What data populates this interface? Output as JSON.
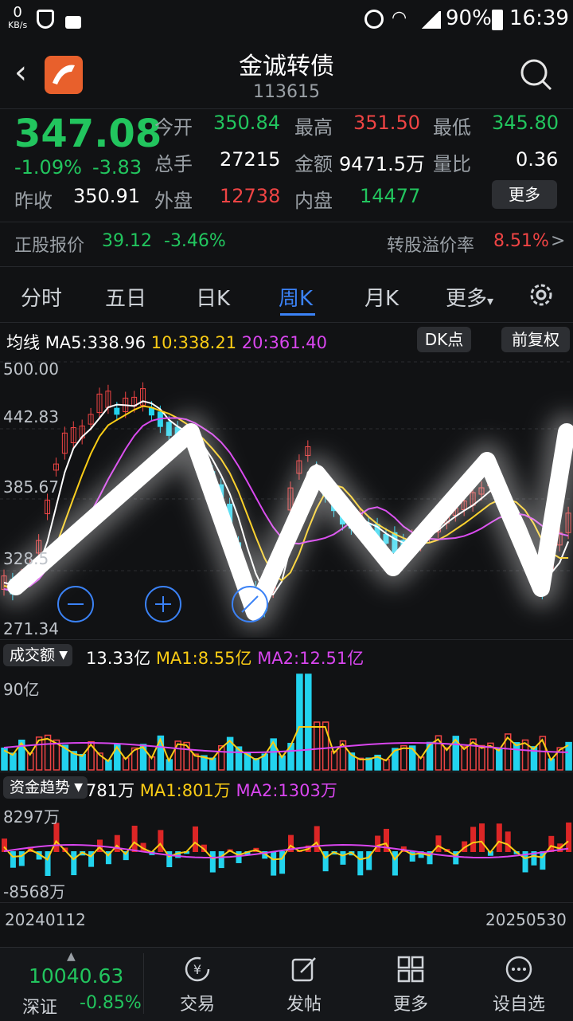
{
  "status_bar": {
    "net_speed": "0",
    "net_unit": "KB/s",
    "battery": "90%",
    "time": "16:39"
  },
  "header": {
    "title": "金诚转债",
    "code": "113615"
  },
  "quote": {
    "price": "347.08",
    "change_pct": "-1.09%",
    "change": "-3.83",
    "prev_close_label": "昨收",
    "prev_close": "350.91",
    "open_label": "今开",
    "open": "350.84",
    "high_label": "最高",
    "high": "351.50",
    "low_label": "最低",
    "low": "345.80",
    "volume_label": "总手",
    "volume": "27215",
    "amount_label": "金额",
    "amount": "9471.5万",
    "ratio_label": "量比",
    "ratio": "0.36",
    "outer_label": "外盘",
    "outer": "12738",
    "inner_label": "内盘",
    "inner": "14477",
    "more_label": "更多"
  },
  "convert": {
    "label": "正股报价",
    "price": "39.12",
    "pct": "-3.46%",
    "premium_label": "转股溢价率",
    "premium": "8.51%",
    "arrow": ">"
  },
  "tabs": {
    "items": [
      "分时",
      "五日",
      "日K",
      "周K",
      "月K",
      "更多"
    ],
    "active": "周K",
    "more_caret": "▾"
  },
  "legend": {
    "ma_label": "均线",
    "ma5": "MA5:338.96",
    "ma10": "10:338.21",
    "ma20": "20:361.40",
    "dk_label": "DK点",
    "adjust_label": "前复权"
  },
  "main_chart": {
    "y_ticks": [
      "500.00",
      "442.83",
      "385.67",
      "328.5",
      "271.34"
    ]
  },
  "volume_panel": {
    "selector": "成交额",
    "value": "13.33亿",
    "ma1": "MA1:8.55亿",
    "ma2": "MA2:12.51亿",
    "top": "90亿"
  },
  "fund_panel": {
    "selector": "资金趋势",
    "value": "781万",
    "ma1": "MA1:801万",
    "ma2": "MA2:1303万",
    "top": "8297万",
    "bottom": "-8568万"
  },
  "date_range": {
    "start": "20240112",
    "end": "20250530"
  },
  "bottom_nav": {
    "index_value": "10040.63",
    "index_name": "深证",
    "index_pct": "-0.85%",
    "items": [
      {
        "label": "交易",
        "icon": "yen-refresh-icon"
      },
      {
        "label": "发帖",
        "icon": "compose-icon"
      },
      {
        "label": "更多",
        "icon": "grid-icon"
      },
      {
        "label": "设自选",
        "icon": "dots-circle-icon"
      }
    ]
  },
  "colors": {
    "up": "#ef4444",
    "down": "#22c55e",
    "accent": "#3b82f6",
    "cyan_bar": "#22d3ee",
    "ma5": "#ffffff",
    "ma10": "#facc15",
    "ma20": "#d946ef"
  }
}
